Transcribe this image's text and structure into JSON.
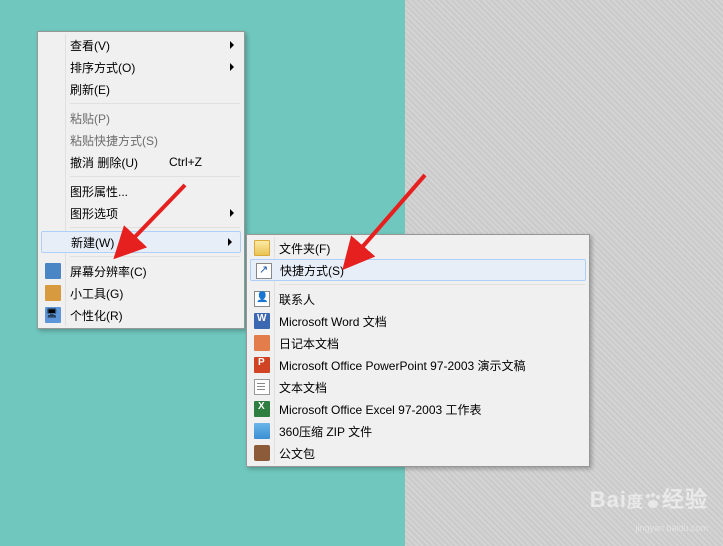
{
  "primary_menu": {
    "view": "查看(V)",
    "sort": "排序方式(O)",
    "refresh": "刷新(E)",
    "paste": "粘贴(P)",
    "paste_shortcut": "粘贴快捷方式(S)",
    "undo": "撤消 删除(U)",
    "undo_shortcut": "Ctrl+Z",
    "graphics_props": "图形属性...",
    "graphics_options": "图形选项",
    "new": "新建(W)",
    "screen_resolution": "屏幕分辨率(C)",
    "gadgets": "小工具(G)",
    "personalize": "个性化(R)"
  },
  "secondary_menu": {
    "folder": "文件夹(F)",
    "shortcut": "快捷方式(S)",
    "contact": "联系人",
    "word": "Microsoft Word 文档",
    "diary": "日记本文档",
    "ppt": "Microsoft Office PowerPoint 97-2003 演示文稿",
    "text": "文本文档",
    "excel": "Microsoft Office Excel 97-2003 工作表",
    "zip": "360压缩 ZIP 文件",
    "briefcase": "公文包"
  },
  "watermark": {
    "brand": "Baidu 经验",
    "url": "jingyan.baidu.com"
  }
}
